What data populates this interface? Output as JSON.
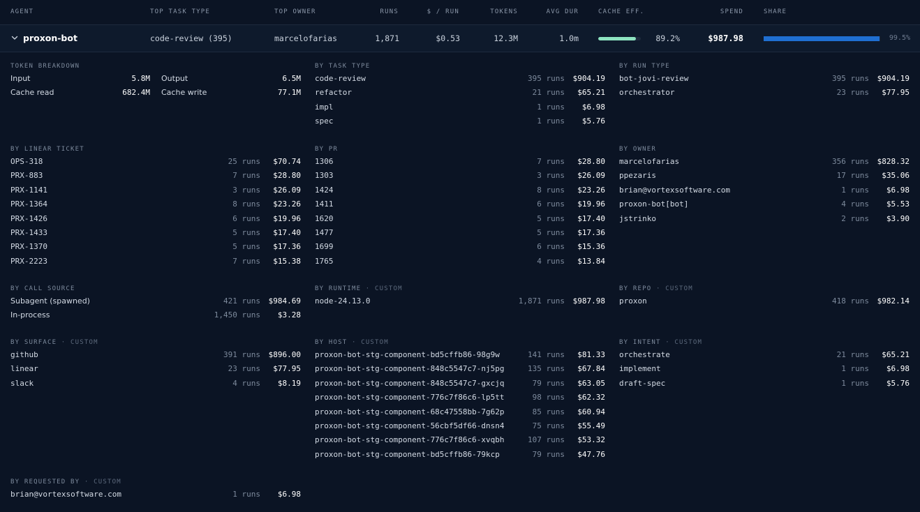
{
  "header": {
    "agent": "AGENT",
    "top_task_type": "TOP TASK TYPE",
    "top_owner": "TOP OWNER",
    "runs": "RUNS",
    "per_run": "$ / RUN",
    "tokens": "TOKENS",
    "avg_dur": "AVG DUR",
    "cache_eff": "CACHE EFF.",
    "spend": "SPEND",
    "share": "SHARE"
  },
  "agent_row": {
    "name": "proxon-bot",
    "top_task_type": "code-review (395)",
    "top_owner": "marcelofarias",
    "runs": "1,871",
    "per_run": "$0.53",
    "tokens": "12.3M",
    "avg_dur": "1.0m",
    "cache_eff": "89.2%",
    "cache_eff_fraction": 0.892,
    "spend": "$987.98",
    "share": "99.5%",
    "share_fraction": 0.995,
    "colors": {
      "cache_bar": "#8de3c0",
      "share_bar": "#1f6fd1"
    },
    "icon": "chevron-down-icon"
  },
  "token_breakdown": {
    "title": "TOKEN BREAKDOWN",
    "rows": [
      {
        "l1": "Input",
        "v1": "5.8M",
        "l2": "Output",
        "v2": "6.5M"
      },
      {
        "l1": "Cache read",
        "v1": "682.4M",
        "l2": "Cache write",
        "v2": "77.1M"
      }
    ]
  },
  "by_task_type": {
    "title": "BY TASK TYPE",
    "tag": "",
    "rows": [
      {
        "label": "code-review",
        "runs": "395 runs",
        "amount": "$904.19"
      },
      {
        "label": "refactor",
        "runs": "21 runs",
        "amount": "$65.21"
      },
      {
        "label": "impl",
        "runs": "1 runs",
        "amount": "$6.98"
      },
      {
        "label": "spec",
        "runs": "1 runs",
        "amount": "$5.76"
      }
    ]
  },
  "by_run_type": {
    "title": "BY RUN TYPE",
    "tag": "",
    "rows": [
      {
        "label": "bot-jovi-review",
        "runs": "395 runs",
        "amount": "$904.19"
      },
      {
        "label": "orchestrator",
        "runs": "23 runs",
        "amount": "$77.95"
      }
    ]
  },
  "by_linear_ticket": {
    "title": "BY LINEAR TICKET",
    "tag": "",
    "rows": [
      {
        "label": "OPS-318",
        "runs": "25 runs",
        "amount": "$70.74"
      },
      {
        "label": "PRX-883",
        "runs": "7 runs",
        "amount": "$28.80"
      },
      {
        "label": "PRX-1141",
        "runs": "3 runs",
        "amount": "$26.09"
      },
      {
        "label": "PRX-1364",
        "runs": "8 runs",
        "amount": "$23.26"
      },
      {
        "label": "PRX-1426",
        "runs": "6 runs",
        "amount": "$19.96"
      },
      {
        "label": "PRX-1433",
        "runs": "5 runs",
        "amount": "$17.40"
      },
      {
        "label": "PRX-1370",
        "runs": "5 runs",
        "amount": "$17.36"
      },
      {
        "label": "PRX-2223",
        "runs": "7 runs",
        "amount": "$15.38"
      }
    ]
  },
  "by_pr": {
    "title": "BY PR",
    "tag": "",
    "rows": [
      {
        "label": "1306",
        "runs": "7 runs",
        "amount": "$28.80"
      },
      {
        "label": "1303",
        "runs": "3 runs",
        "amount": "$26.09"
      },
      {
        "label": "1424",
        "runs": "8 runs",
        "amount": "$23.26"
      },
      {
        "label": "1411",
        "runs": "6 runs",
        "amount": "$19.96"
      },
      {
        "label": "1620",
        "runs": "5 runs",
        "amount": "$17.40"
      },
      {
        "label": "1477",
        "runs": "5 runs",
        "amount": "$17.36"
      },
      {
        "label": "1699",
        "runs": "6 runs",
        "amount": "$15.36"
      },
      {
        "label": "1765",
        "runs": "4 runs",
        "amount": "$13.84"
      }
    ]
  },
  "by_owner": {
    "title": "BY OWNER",
    "tag": "",
    "rows": [
      {
        "label": "marcelofarias",
        "runs": "356 runs",
        "amount": "$828.32"
      },
      {
        "label": "ppezaris",
        "runs": "17 runs",
        "amount": "$35.06"
      },
      {
        "label": "brian@vortexsoftware.com",
        "runs": "1 runs",
        "amount": "$6.98"
      },
      {
        "label": "proxon-bot[bot]",
        "runs": "4 runs",
        "amount": "$5.53"
      },
      {
        "label": "jstrinko",
        "runs": "2 runs",
        "amount": "$3.90"
      }
    ]
  },
  "by_call_source": {
    "title": "BY CALL SOURCE",
    "tag": "",
    "rows": [
      {
        "label": "Subagent (spawned)",
        "runs": "421 runs",
        "amount": "$984.69"
      },
      {
        "label": "In-process",
        "runs": "1,450 runs",
        "amount": "$3.28"
      }
    ]
  },
  "by_runtime": {
    "title": "BY RUNTIME",
    "tag": " · CUSTOM",
    "rows": [
      {
        "label": "node-24.13.0",
        "runs": "1,871 runs",
        "amount": "$987.98"
      }
    ]
  },
  "by_repo": {
    "title": "BY REPO",
    "tag": " · CUSTOM",
    "rows": [
      {
        "label": "proxon",
        "runs": "418 runs",
        "amount": "$982.14"
      }
    ]
  },
  "by_surface": {
    "title": "BY SURFACE",
    "tag": " · CUSTOM",
    "rows": [
      {
        "label": "github",
        "runs": "391 runs",
        "amount": "$896.00"
      },
      {
        "label": "linear",
        "runs": "23 runs",
        "amount": "$77.95"
      },
      {
        "label": "slack",
        "runs": "4 runs",
        "amount": "$8.19"
      }
    ]
  },
  "by_host": {
    "title": "BY HOST",
    "tag": " · CUSTOM",
    "rows": [
      {
        "label": "proxon-bot-stg-component-bd5cffb86-98g9w",
        "runs": "141 runs",
        "amount": "$81.33"
      },
      {
        "label": "proxon-bot-stg-component-848c5547c7-nj5pg",
        "runs": "135 runs",
        "amount": "$67.84"
      },
      {
        "label": "proxon-bot-stg-component-848c5547c7-gxcjq",
        "runs": "79 runs",
        "amount": "$63.05"
      },
      {
        "label": "proxon-bot-stg-component-776c7f86c6-lp5tt",
        "runs": "98 runs",
        "amount": "$62.32"
      },
      {
        "label": "proxon-bot-stg-component-68c47558bb-7g62p",
        "runs": "85 runs",
        "amount": "$60.94"
      },
      {
        "label": "proxon-bot-stg-component-56cbf5df66-dnsn4",
        "runs": "75 runs",
        "amount": "$55.49"
      },
      {
        "label": "proxon-bot-stg-component-776c7f86c6-xvqbh",
        "runs": "107 runs",
        "amount": "$53.32"
      },
      {
        "label": "proxon-bot-stg-component-bd5cffb86-79kcp",
        "runs": "79 runs",
        "amount": "$47.76"
      }
    ]
  },
  "by_intent": {
    "title": "BY INTENT",
    "tag": " · CUSTOM",
    "rows": [
      {
        "label": "orchestrate",
        "runs": "21 runs",
        "amount": "$65.21"
      },
      {
        "label": "implement",
        "runs": "1 runs",
        "amount": "$6.98"
      },
      {
        "label": "draft-spec",
        "runs": "1 runs",
        "amount": "$5.76"
      }
    ]
  },
  "by_requested_by": {
    "title": "BY REQUESTED BY",
    "tag": " · CUSTOM",
    "rows": [
      {
        "label": "brian@vortexsoftware.com",
        "runs": "1 runs",
        "amount": "$6.98"
      }
    ]
  }
}
